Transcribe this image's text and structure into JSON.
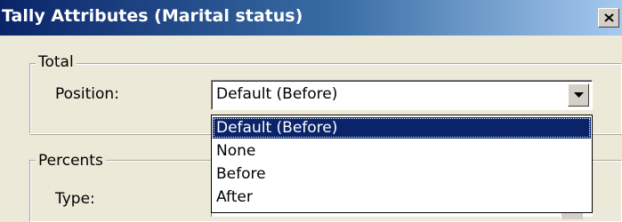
{
  "window": {
    "title": "Tally Attributes (Marital status)",
    "close_icon": "close-icon"
  },
  "total_group": {
    "legend": "Total",
    "position_label": "Position:",
    "position_value": "Default (Before)"
  },
  "position_dropdown": {
    "options": [
      "Default (Before)",
      "None",
      "Before",
      "After"
    ],
    "selected_index": 0
  },
  "percents_group": {
    "legend": "Percents",
    "type_label": "Type:"
  },
  "colors": {
    "title_bar_start": "#0a246a",
    "title_bar_end": "#a6caf0",
    "selection": "#0a246a",
    "dialog_bg": "#ece9d8"
  }
}
